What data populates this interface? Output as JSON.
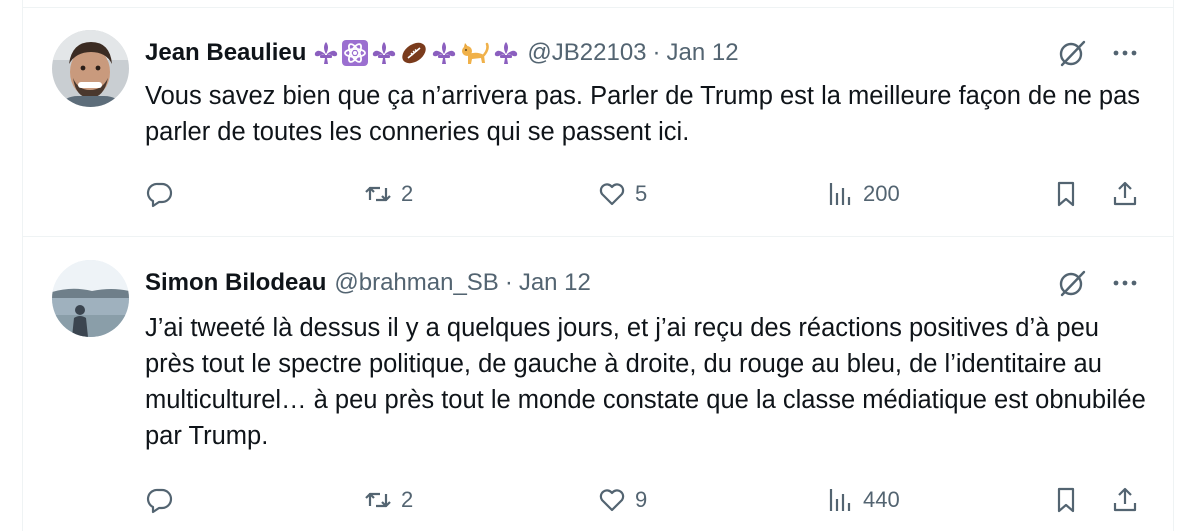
{
  "tweets": [
    {
      "display_name": "Jean Beaulieu",
      "name_emojis": [
        "fleur-de-lis",
        "atom-symbol",
        "fleur-de-lis",
        "american-football",
        "fleur-de-lis",
        "cat",
        "fleur-de-lis"
      ],
      "handle": "@JB22103",
      "separator": "·",
      "date": "Jan 12",
      "text": "Vous savez bien que ça n’arrivera pas. Parler de Trump est la meilleure façon de ne pas parler de toutes les conneries qui se passent ici.",
      "reposts": "2",
      "likes": "5",
      "views": "200",
      "icons": [
        "reply-icon",
        "repost-icon",
        "like-icon",
        "views-icon",
        "bookmark-icon",
        "share-icon",
        "grok-icon",
        "more-icon"
      ]
    },
    {
      "display_name": "Simon Bilodeau",
      "name_emojis": [],
      "handle": "@brahman_SB",
      "separator": "·",
      "date": "Jan 12",
      "text": "J’ai tweeté là dessus il y a quelques jours, et j’ai reçu des réactions positives d’à peu près tout le spectre politique, de gauche à droite, du rouge au bleu, de l’identitaire au multiculturel… à peu près tout le monde constate que la classe médiatique est obnubilée par Trump.",
      "reposts": "2",
      "likes": "9",
      "views": "440",
      "icons": [
        "reply-icon",
        "repost-icon",
        "like-icon",
        "views-icon",
        "bookmark-icon",
        "share-icon",
        "grok-icon",
        "more-icon"
      ]
    }
  ],
  "colors": {
    "text_primary": "#0f1419",
    "text_secondary": "#536471",
    "divider": "#eff3f4",
    "fleur_de_lis": "#8b5fbf",
    "atom_tile": "#9b6fd0"
  }
}
